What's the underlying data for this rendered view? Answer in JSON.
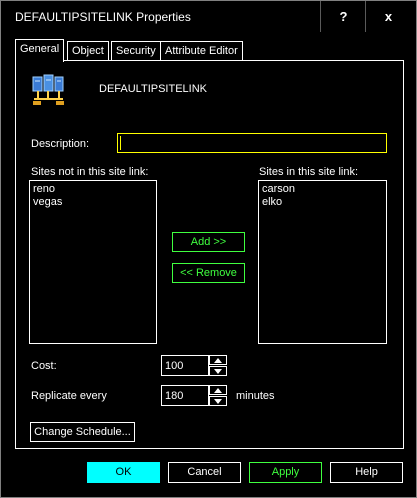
{
  "window": {
    "title": "DEFAULTIPSITELINK Properties",
    "help_label": "?",
    "close_label": "x"
  },
  "tabs": [
    {
      "label": "General",
      "active": true
    },
    {
      "label": "Object",
      "active": false
    },
    {
      "label": "Security",
      "active": false
    },
    {
      "label": "Attribute Editor",
      "active": false
    }
  ],
  "general": {
    "object_name": "DEFAULTIPSITELINK",
    "description_label": "Description:",
    "description_value": "",
    "sites_not_label": "Sites not in this site link:",
    "sites_not": [
      "reno",
      "vegas"
    ],
    "sites_in_label": "Sites in this site link:",
    "sites_in": [
      "carson",
      "elko"
    ],
    "add_label": "Add >>",
    "remove_label": "<< Remove",
    "cost_label": "Cost:",
    "cost_value": "100",
    "replicate_label": "Replicate every",
    "replicate_value": "180",
    "minutes_label": "minutes",
    "change_schedule_label": "Change Schedule..."
  },
  "footer": {
    "ok_label": "OK",
    "cancel_label": "Cancel",
    "apply_label": "Apply",
    "help_label": "Help"
  },
  "colors": {
    "background": "#000000",
    "text": "#ffffff",
    "accent_focus": "#ffff00",
    "button_enabled_green": "#3fff3f",
    "default_button": "#00ffff"
  },
  "icons": {
    "site_link": "site-link-icon",
    "spin_up": "spin-up-icon",
    "spin_down": "spin-down-icon"
  }
}
